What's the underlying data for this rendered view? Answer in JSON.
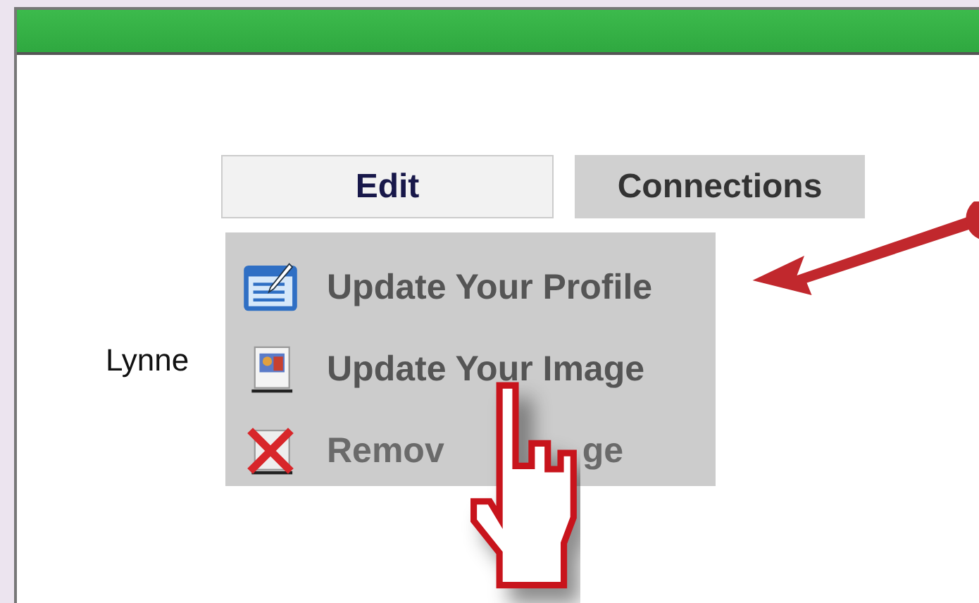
{
  "tabs": [
    {
      "label": "Edit",
      "selected": true
    },
    {
      "label": "Connections",
      "selected": false
    }
  ],
  "user_name": "Lynne",
  "menu": [
    {
      "kind": "profile",
      "label": "Update Your Profile",
      "disabled": false
    },
    {
      "kind": "image",
      "label": "Update Your Image",
      "disabled": false
    },
    {
      "kind": "remove",
      "label": "Remov",
      "label_tail": "ge",
      "disabled": true
    }
  ]
}
